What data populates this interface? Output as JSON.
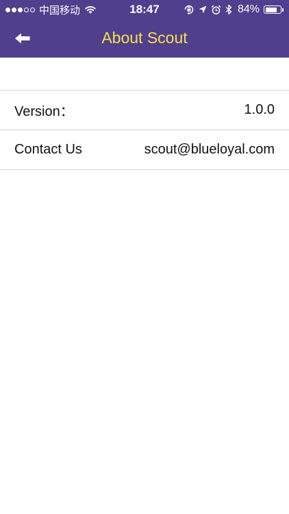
{
  "status_bar": {
    "carrier": "中国移动",
    "time": "18:47",
    "battery_percent": "84%",
    "battery_level": 0.84,
    "signal_bars_total": 5,
    "signal_bars_filled": 3
  },
  "nav": {
    "title": "About Scout",
    "title_color": "#f4e04d",
    "bar_color": "#4f3f8d"
  },
  "rows": [
    {
      "label": "Version：",
      "value": "1.0.0"
    },
    {
      "label": "Contact Us",
      "value": "scout@blueloyal.com"
    }
  ]
}
